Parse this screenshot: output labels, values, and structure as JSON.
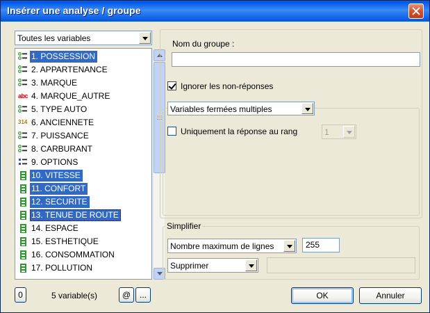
{
  "window": {
    "title": "Insérer une analyse / groupe"
  },
  "variable_filter": {
    "selected": "Toutes les variables"
  },
  "variables": [
    {
      "label": "1. POSSESSION",
      "icon": "closed-question-icon",
      "selected": true,
      "focused": false
    },
    {
      "label": "2. APPARTENANCE",
      "icon": "closed-question-icon",
      "selected": false
    },
    {
      "label": "3. MARQUE",
      "icon": "closed-question-icon",
      "selected": false
    },
    {
      "label": "4. MARQUE_AUTRE",
      "icon": "text-variable-icon",
      "icon_text": "abc",
      "selected": false
    },
    {
      "label": "5. TYPE AUTO",
      "icon": "closed-question-icon",
      "selected": false
    },
    {
      "label": "6. ANCIENNETE",
      "icon": "numeric-variable-icon",
      "icon_text": "314",
      "selected": false
    },
    {
      "label": "7. PUISSANCE",
      "icon": "closed-question-icon",
      "selected": false
    },
    {
      "label": "8. CARBURANT",
      "icon": "closed-question-icon",
      "selected": false
    },
    {
      "label": "9. OPTIONS",
      "icon": "multiple-question-icon",
      "selected": false
    },
    {
      "label": "10. VITESSE",
      "icon": "scale-variable-icon",
      "selected": true
    },
    {
      "label": "11. CONFORT",
      "icon": "scale-variable-icon",
      "selected": true
    },
    {
      "label": "12. SECURITE",
      "icon": "scale-variable-icon",
      "selected": true
    },
    {
      "label": "13. TENUE DE ROUTE",
      "icon": "scale-variable-icon",
      "selected": true,
      "focused": true
    },
    {
      "label": "14. ESPACE",
      "icon": "scale-variable-icon",
      "selected": false
    },
    {
      "label": "15. ESTHETIQUE",
      "icon": "scale-variable-icon",
      "selected": false
    },
    {
      "label": "16. CONSOMMATION",
      "icon": "scale-variable-icon",
      "selected": false
    },
    {
      "label": "17. POLLUTION",
      "icon": "scale-variable-icon",
      "selected": false
    }
  ],
  "group_name": {
    "label": "Nom du groupe :",
    "value": ""
  },
  "ignore_nonresponses": {
    "label": "Ignorer les non-réponses",
    "checked": true
  },
  "variable_type": {
    "selected": "Variables fermées multiples"
  },
  "rank_only": {
    "label": "Uniquement la réponse au rang",
    "checked": false,
    "rank_value": "1"
  },
  "simplify": {
    "title": "Simplifier",
    "mode": "Nombre maximum de lignes",
    "max_lines": "255",
    "action": "Supprimer",
    "action_value": ""
  },
  "footer": {
    "zero_label": "0",
    "selection_count": "5 variable(s)",
    "at_label": "@",
    "more_label": "...",
    "ok_label": "OK",
    "cancel_label": "Annuler"
  },
  "colors": {
    "selection": "#316ac5",
    "title_bar": "#0054e3",
    "dialog_bg": "#ece9d8",
    "scale_icon": "#2a9a2a"
  }
}
